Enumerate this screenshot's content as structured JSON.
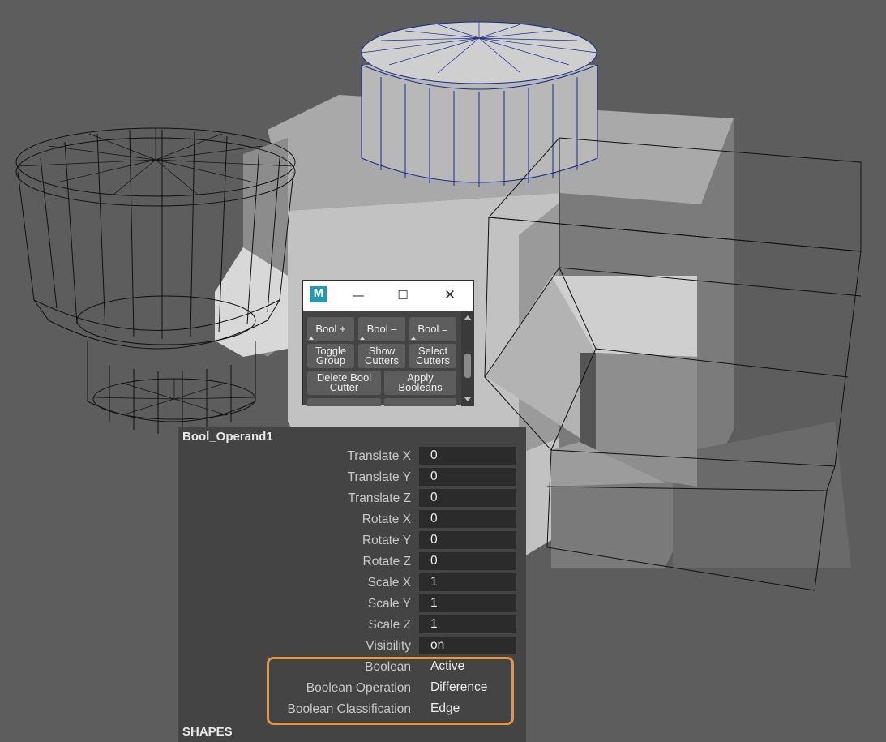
{
  "tool_window": {
    "app_icon_letter": "M",
    "minimize_glyph": "—",
    "maximize_glyph": "☐",
    "close_glyph": "✕",
    "buttons": [
      {
        "label": "Bool +"
      },
      {
        "label": "Bool –"
      },
      {
        "label": "Bool ="
      },
      {
        "label": "Toggle\nGroup"
      },
      {
        "label": "Show\nCutters"
      },
      {
        "label": "Select\nCutters"
      },
      {
        "label": "Delete Bool\nCutter"
      },
      {
        "label": "Apply\nBooleans"
      }
    ]
  },
  "channel_box": {
    "object_name": "Bool_Operand1",
    "attributes": [
      {
        "label": "Translate X",
        "value": "0"
      },
      {
        "label": "Translate Y",
        "value": "0"
      },
      {
        "label": "Translate Z",
        "value": "0"
      },
      {
        "label": "Rotate X",
        "value": "0"
      },
      {
        "label": "Rotate Y",
        "value": "0"
      },
      {
        "label": "Rotate Z",
        "value": "0"
      },
      {
        "label": "Scale X",
        "value": "1"
      },
      {
        "label": "Scale Y",
        "value": "1"
      },
      {
        "label": "Scale Z",
        "value": "1"
      },
      {
        "label": "Visibility",
        "value": "on"
      },
      {
        "label": "Boolean",
        "value": "Active"
      },
      {
        "label": "Boolean Operation",
        "value": "Difference"
      },
      {
        "label": "Boolean Classification",
        "value": "Edge"
      }
    ],
    "shapes_header": "SHAPES"
  },
  "colors": {
    "viewport_bg": "#5d5d5d",
    "highlight": "#e0954b",
    "wire_selected": "#1a2a8a"
  }
}
